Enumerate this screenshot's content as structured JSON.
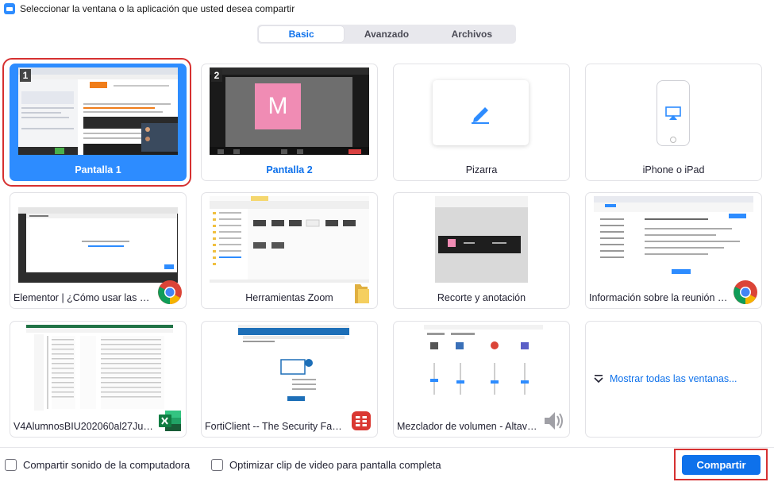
{
  "window": {
    "title": "Seleccionar la ventana o la aplicación que usted desea compartir"
  },
  "tabs": [
    {
      "label": "Basic",
      "active": true
    },
    {
      "label": "Avanzado",
      "active": false
    },
    {
      "label": "Archivos",
      "active": false
    }
  ],
  "cards": {
    "screen1": {
      "label": "Pantalla 1",
      "number": "1"
    },
    "screen2": {
      "label": "Pantalla 2",
      "number": "2",
      "avatar_letter": "M"
    },
    "whiteboard": {
      "label": "Pizarra"
    },
    "iphone": {
      "label": "iPhone o iPad"
    },
    "elementor": {
      "label": "Elementor | ¿Cómo usar las herra..."
    },
    "zoom_tools": {
      "label": "Herramientas Zoom"
    },
    "snip": {
      "label": "Recorte y anotación"
    },
    "meeting_info": {
      "label": "Información sobre la reunión - Z..."
    },
    "excel": {
      "label": "V4AlumnosBIU202060al27Julio - ..."
    },
    "forticlient": {
      "label": "FortiClient -- The Security Fabric ..."
    },
    "mixer": {
      "label": "Mezclador de volumen - Altavoc..."
    },
    "show_all": {
      "label": "Mostrar todas las ventanas..."
    }
  },
  "options": {
    "share_sound": "Compartir sonido de la computadora",
    "optimize_video": "Optimizar clip de video para pantalla completa"
  },
  "actions": {
    "share": "Compartir"
  },
  "colors": {
    "accent": "#0e71eb",
    "selected": "#2d8cff",
    "highlight": "#d63131"
  }
}
